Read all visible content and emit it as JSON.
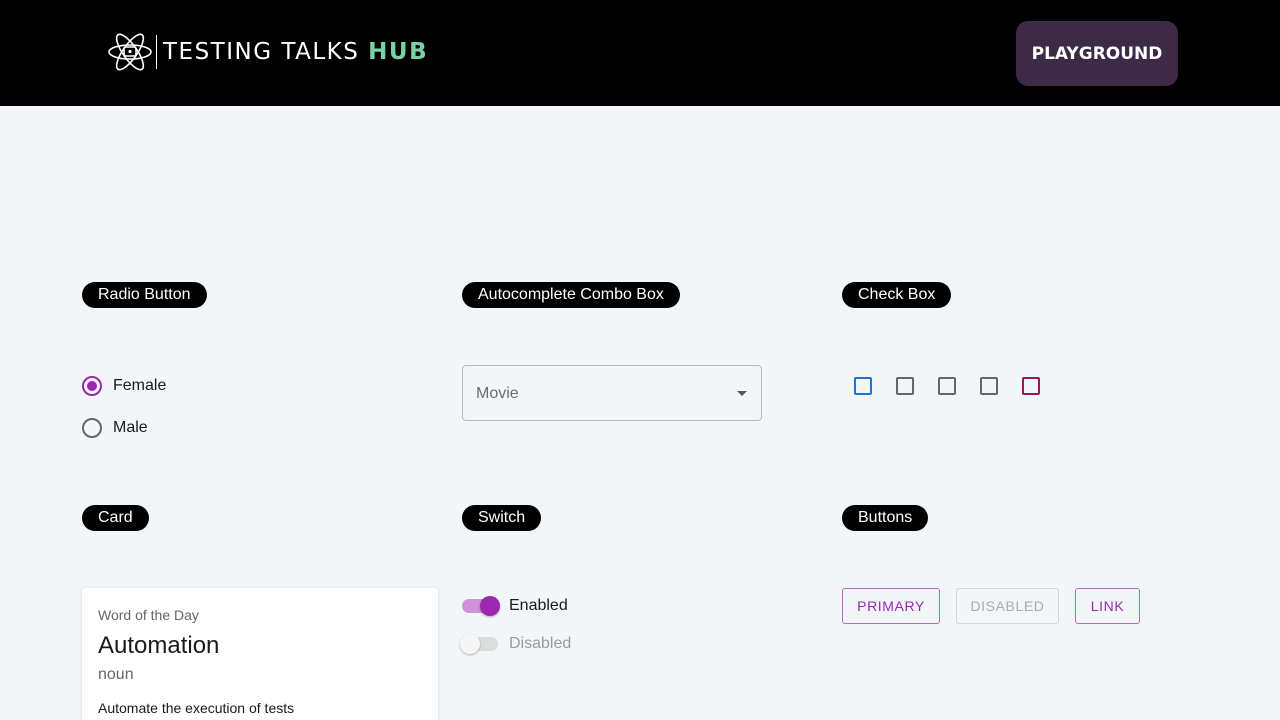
{
  "header": {
    "logo_text": "TESTING TALKS ",
    "logo_highlight": "HUB",
    "playground_label": "PLAYGROUND"
  },
  "sections": {
    "radio": "Radio Button",
    "combo": "Autocomplete Combo Box",
    "checkbox": "Check Box",
    "card": "Card",
    "switch": "Switch",
    "buttons": "Buttons"
  },
  "radio": {
    "options": [
      {
        "label": "Female",
        "checked": true
      },
      {
        "label": "Male",
        "checked": false
      }
    ]
  },
  "combo": {
    "placeholder": "Movie",
    "value": ""
  },
  "checkboxes": [
    {
      "checked": false,
      "color": "#1976d2"
    },
    {
      "checked": false,
      "color": "#666666"
    },
    {
      "checked": false,
      "color": "#666666"
    },
    {
      "checked": false,
      "color": "#666666"
    },
    {
      "checked": false,
      "color": "#a0145a"
    }
  ],
  "card": {
    "overline": "Word of the Day",
    "title": "Automation",
    "subtitle": "noun",
    "body": "Automate the execution of tests"
  },
  "switches": [
    {
      "label": "Enabled",
      "on": true,
      "disabled": false
    },
    {
      "label": "Disabled",
      "on": false,
      "disabled": true
    }
  ],
  "buttons": {
    "primary": "PRIMARY",
    "disabled": "DISABLED",
    "link": "LINK"
  },
  "colors": {
    "accent": "#9c27b0",
    "header_bg": "#000000",
    "playground_bg": "#3d2a46",
    "hub_green": "#79d2a6"
  }
}
